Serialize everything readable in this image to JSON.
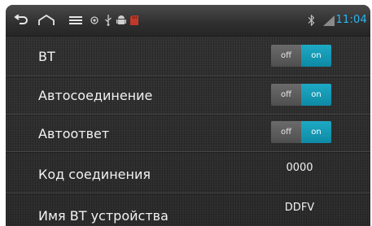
{
  "status_bar": {
    "time": "11:04",
    "icons": [
      "back-icon",
      "home-icon",
      "menu-icon",
      "gps-icon",
      "usb-icon",
      "android-debug-icon",
      "sd-card-icon",
      "bluetooth-icon",
      "signal-icon"
    ],
    "time_color": "#29b6f6"
  },
  "settings": {
    "bt": {
      "label": "BT",
      "off_label": "off",
      "on_label": "on",
      "state": "on"
    },
    "auto_connect": {
      "label": "Автосоединение",
      "off_label": "off",
      "on_label": "on",
      "state": "on"
    },
    "auto_answer": {
      "label": "Автоответ",
      "off_label": "off",
      "on_label": "on",
      "state": "on"
    },
    "pairing_code": {
      "label": "Код соединения",
      "value": "0000"
    },
    "device_name": {
      "label": "Имя BT устройства",
      "value": "DDFV"
    }
  },
  "colors": {
    "toggle_on": "#1ea9c4",
    "toggle_off": "#5c5c5c",
    "background": "#2e2e2e"
  }
}
